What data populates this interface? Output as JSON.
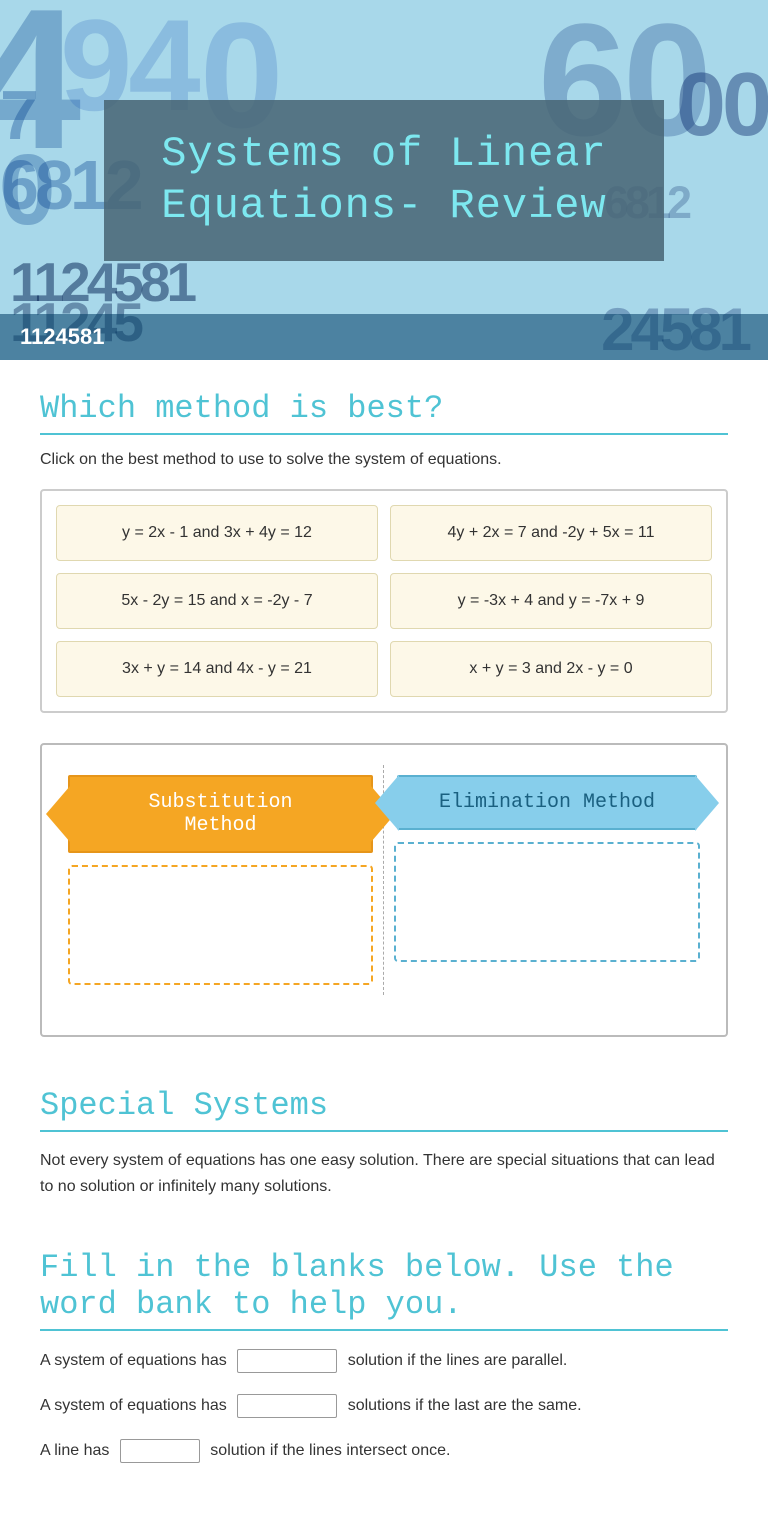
{
  "hero": {
    "title": "Systems of Linear Equations- Review",
    "bottom_bar": "1124581"
  },
  "section1": {
    "heading": "Which method is best?",
    "description": "Click on the best method to use to solve the system of equations.",
    "equations": [
      {
        "id": "eq1",
        "text": "y = 2x - 1  and  3x + 4y = 12"
      },
      {
        "id": "eq2",
        "text": "4y + 2x = 7  and  -2y + 5x = 11"
      },
      {
        "id": "eq3",
        "text": "5x - 2y = 15  and x = -2y - 7"
      },
      {
        "id": "eq4",
        "text": "y = -3x + 4 and y = -7x + 9"
      },
      {
        "id": "eq5",
        "text": "3x + y = 14  and  4x - y = 21"
      },
      {
        "id": "eq6",
        "text": "x + y = 3  and  2x - y = 0"
      }
    ]
  },
  "methods": {
    "substitution": {
      "label": "Substitution Method"
    },
    "elimination": {
      "label": "Elimination Method"
    }
  },
  "special_section": {
    "heading": "Special Systems",
    "body": "Not every system of equations has one easy solution.  There are special situations that can lead to no solution or infinitely many solutions."
  },
  "fill_section": {
    "heading": "Fill in the blanks below. Use the word bank to help you.",
    "lines": [
      {
        "before": "A system of equations has",
        "after": "solution if the lines are parallel."
      },
      {
        "before": "A system of equations has",
        "after": "solutions if the last are the same."
      },
      {
        "before": "A line has",
        "after": "solution if the lines intersect once."
      }
    ]
  }
}
